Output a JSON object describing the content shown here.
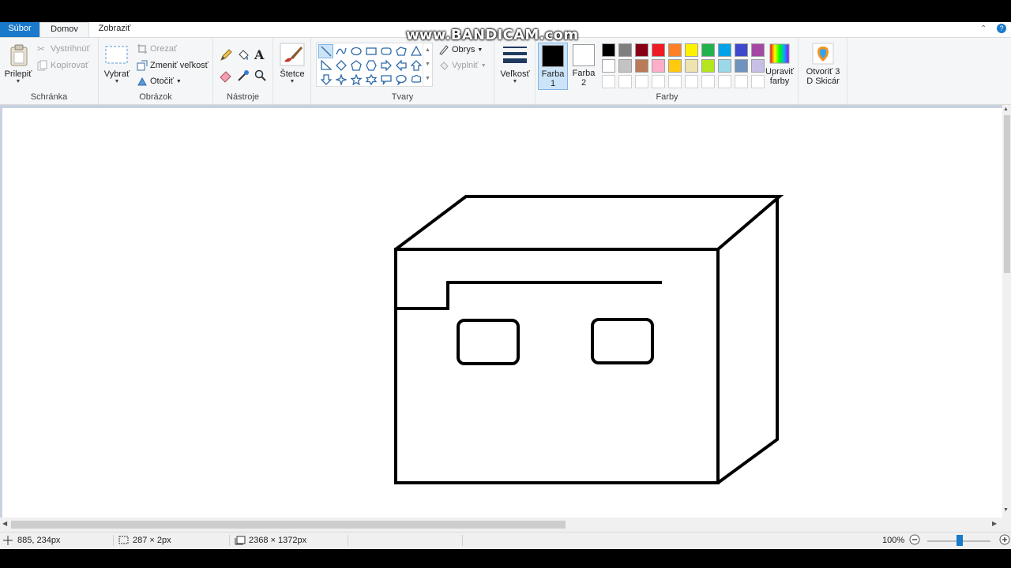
{
  "watermark": "www.BANDICAM.com",
  "tabs": {
    "file": "Súbor",
    "home": "Domov",
    "view": "Zobraziť"
  },
  "clipboard": {
    "paste": "Prilepiť",
    "cut": "Vystrihnúť",
    "copy": "Kopírovať",
    "group_label": "Schránka"
  },
  "image": {
    "select": "Vybrať",
    "crop": "Orezať",
    "resize": "Zmeniť veľkosť",
    "rotate": "Otočiť",
    "group_label": "Obrázok"
  },
  "tools": {
    "group_label": "Nástroje"
  },
  "brushes": {
    "label": "Štetce"
  },
  "shapes": {
    "outline": "Obrys",
    "fill": "Vyplniť",
    "group_label": "Tvary"
  },
  "size": {
    "label": "Veľkosť"
  },
  "colors": {
    "color1_label": "Farba",
    "color1_num": "1",
    "color2_label": "Farba",
    "color2_num": "2",
    "edit_line1": "Upraviť",
    "edit_line2": "farby",
    "group_label": "Farby",
    "color1_value": "#000000",
    "color2_value": "#ffffff",
    "palette": [
      "#000000",
      "#7f7f7f",
      "#880015",
      "#ed1c24",
      "#ff7f27",
      "#fff200",
      "#22b14c",
      "#00a2e8",
      "#3f48cc",
      "#a349a4",
      "#ffffff",
      "#c3c3c3",
      "#b97a57",
      "#ffaec9",
      "#ffc90e",
      "#efe4b0",
      "#b5e61d",
      "#99d9ea",
      "#7092be",
      "#c8bfe7",
      "#ffffff",
      "#ffffff",
      "#ffffff",
      "#ffffff",
      "#ffffff",
      "#ffffff",
      "#ffffff",
      "#ffffff",
      "#ffffff",
      "#ffffff"
    ]
  },
  "paint3d": {
    "line1": "Otvoriť 3",
    "line2": "D Skicár"
  },
  "status": {
    "cursor_pos": "885, 234px",
    "selection_size": "287 × 2px",
    "image_size": "2368 × 1372px",
    "zoom": "100%"
  }
}
